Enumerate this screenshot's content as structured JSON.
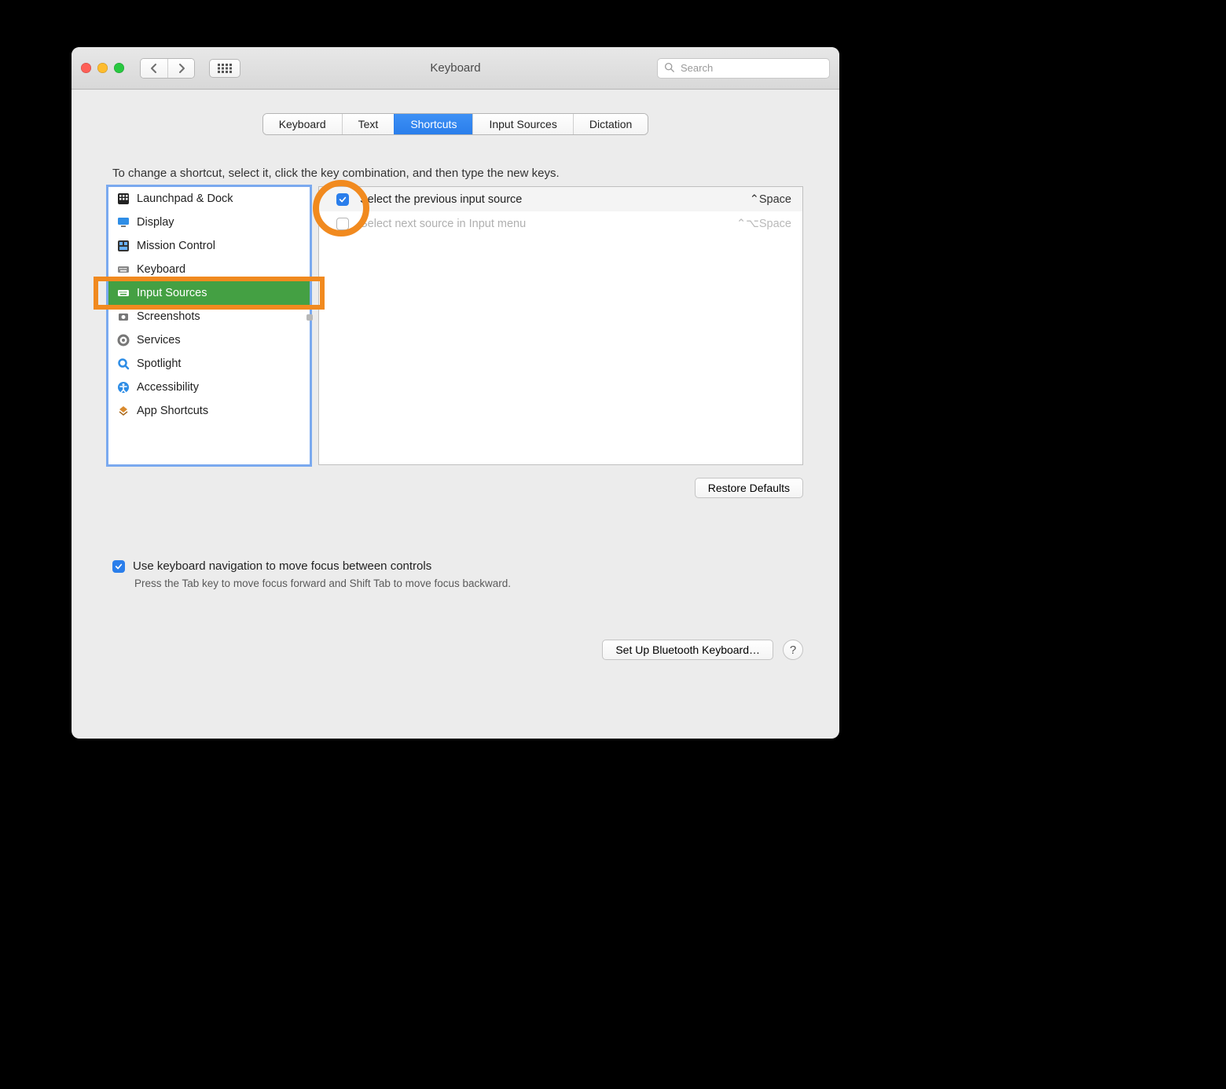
{
  "window": {
    "title": "Keyboard"
  },
  "search": {
    "placeholder": "Search"
  },
  "tabs": [
    {
      "label": "Keyboard",
      "active": false
    },
    {
      "label": "Text",
      "active": false
    },
    {
      "label": "Shortcuts",
      "active": true
    },
    {
      "label": "Input Sources",
      "active": false
    },
    {
      "label": "Dictation",
      "active": false
    }
  ],
  "prompt": "To change a shortcut, select it, click the key combination, and then type the new keys.",
  "sidebar": {
    "items": [
      {
        "label": "Launchpad & Dock",
        "selected": false,
        "icon": "launchpad"
      },
      {
        "label": "Display",
        "selected": false,
        "icon": "display"
      },
      {
        "label": "Mission Control",
        "selected": false,
        "icon": "mission"
      },
      {
        "label": "Keyboard",
        "selected": false,
        "icon": "keyboard"
      },
      {
        "label": "Input Sources",
        "selected": true,
        "icon": "keyboard"
      },
      {
        "label": "Screenshots",
        "selected": false,
        "icon": "screenshot"
      },
      {
        "label": "Services",
        "selected": false,
        "icon": "gear"
      },
      {
        "label": "Spotlight",
        "selected": false,
        "icon": "spotlight"
      },
      {
        "label": "Accessibility",
        "selected": false,
        "icon": "accessibility"
      },
      {
        "label": "App Shortcuts",
        "selected": false,
        "icon": "app"
      }
    ]
  },
  "shortcuts": [
    {
      "checked": true,
      "label": "Select the previous input source",
      "key": "⌃Space",
      "disabled": false
    },
    {
      "checked": false,
      "label": "Select next source in Input menu",
      "key": "⌃⌥Space",
      "disabled": true
    }
  ],
  "buttons": {
    "restore": "Restore Defaults",
    "bluetooth": "Set Up Bluetooth Keyboard…"
  },
  "footer": {
    "checkbox_label": "Use keyboard navigation to move focus between controls",
    "checkbox_checked": true,
    "sub": "Press the Tab key to move focus forward and Shift Tab to move focus backward."
  }
}
